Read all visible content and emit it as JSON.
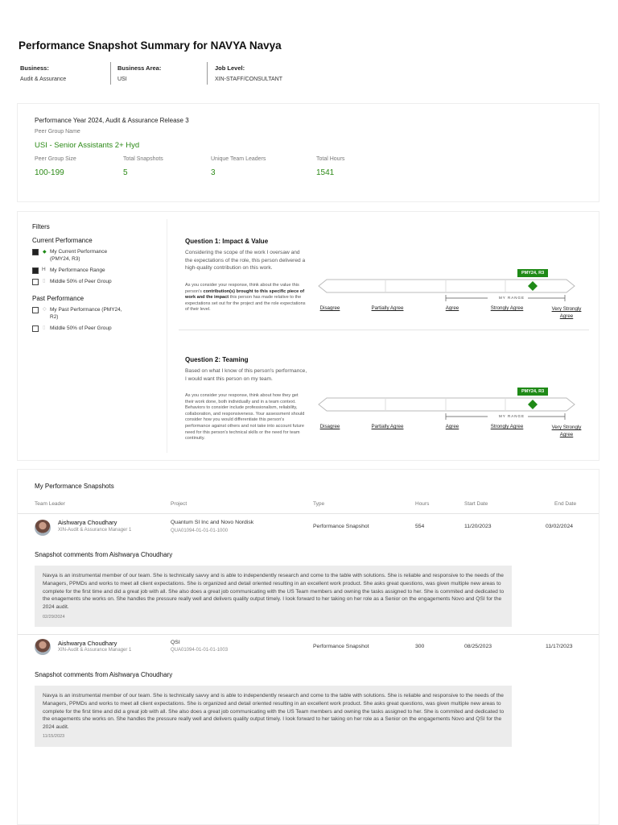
{
  "page": {
    "title": "Performance Snapshot Summary for NAVYA Navya"
  },
  "meta": {
    "business_label": "Business:",
    "business_value": "Audit & Assurance",
    "area_label": "Business Area:",
    "area_value": "USI",
    "level_label": "Job Level:",
    "level_value": "XIN-STAFF/CONSULTANT"
  },
  "summary": {
    "year_title": "Performance Year 2024, Audit & Assurance Release 3",
    "peer_group_label": "Peer Group Name",
    "peer_group_value": "USI - Senior Assistants 2+ Hyd",
    "stats": [
      {
        "label": "Peer Group Size",
        "value": "100-199"
      },
      {
        "label": "Total Snapshots",
        "value": "5"
      },
      {
        "label": "Unique Team Leaders",
        "value": "3"
      },
      {
        "label": "Total Hours",
        "value": "1541"
      }
    ]
  },
  "filters": {
    "title": "Filters",
    "current_heading": "Current Performance",
    "current_items": [
      {
        "label": "My Current Performance (PMY24, R3)",
        "checked": true
      },
      {
        "label": "My Performance Range",
        "checked": true
      },
      {
        "label": "Middle 50% of Peer Group",
        "checked": false
      }
    ],
    "past_heading": "Past Performance",
    "past_items": [
      {
        "label": "My Past Performance (PMY24, R2)",
        "checked": false
      },
      {
        "label": "Middle 50% of Peer Group",
        "checked": false
      }
    ]
  },
  "questions": [
    {
      "title": "Question 1: Impact & Value",
      "text": "Considering the scope of the work I oversaw and the expectations of the role, this person delivered a high-quality contribution on this work.",
      "note_pre": "As you consider your response, think about the value this person's ",
      "note_bold": "contribution(s) brought to this specific piece of work and the impact",
      "note_post": " this person has made relative to the expectations set out for the project and the role expectations of their level.",
      "badge": "PMY24, R3",
      "range_label": "MY RANGE",
      "scale": [
        "Disagree",
        "Partially Agree",
        "Agree",
        "Strongly Agree",
        "Very Strongly Agree"
      ]
    },
    {
      "title": "Question 2: Teaming",
      "text": "Based on what I know of this person's performance, I would want this person on my team.",
      "note_pre": "As you consider your response, think about how they get their work done, both individually and in a team context. Behaviors to consider include professionalism, reliability, collaboration, and responsiveness. Your assessment should consider how you would differentiate this person's performance against others and not take into account future need for this person's technical skills or the need for team continuity.",
      "note_bold": "",
      "note_post": "",
      "badge": "PMY24, R3",
      "range_label": "MY RANGE",
      "scale": [
        "Disagree",
        "Partially Agree",
        "Agree",
        "Strongly Agree",
        "Very Strongly Agree"
      ]
    }
  ],
  "snapshots": {
    "title": "My Performance Snapshots",
    "columns": [
      "Team Leader",
      "Project",
      "Type",
      "Hours",
      "Start Date",
      "End Date"
    ],
    "rows": [
      {
        "leader": "Aishwarya Choudhary",
        "leader_role": "XIN-Audit & Assurance Manager 1",
        "project": "Quantum SI Inc and Novo Nordisk",
        "project_code": "QUA01094-01-01-01-1000",
        "type": "Performance Snapshot",
        "hours": "554",
        "start": "11/20/2023",
        "end": "03/02/2024",
        "comment_heading": "Snapshot comments from Aishwarya Choudhary",
        "comment": "Navya is an instrumental member of our team. She is technically savvy and is able to independently research and come to the table with solutions. She is reliable and responsive to the needs of the Managers, PPMDs and works to meet all client expectations. She is organized and detail oriented resulting in an excellent work product. She asks great questions, was given multiple new areas to complete for the first time and did a great job with all. She also does a great job communicating with the US Team members and owning the tasks assigned to her. She is commited and dedicated to the enagements she works on. She handles the pressure really well and delivers quality output timely. I look forward to her taking on her role as a Senior on the engagements Novo and QSI for the 2024 audit.",
        "comment_date": "02/29/2024"
      },
      {
        "leader": "Aishwarya Choudhary",
        "leader_role": "XIN-Audit & Assurance Manager 1",
        "project": "QSI",
        "project_code": "QUA01094-01-01-01-1003",
        "type": "Performance Snapshot",
        "hours": "300",
        "start": "08/25/2023",
        "end": "11/17/2023",
        "comment_heading": "Snapshot comments from Aishwarya Choudhary",
        "comment": "Navya is an instrumental member of our team. She is technically savvy and is able to independently research and come to the table with solutions. She is reliable and responsive to the needs of the Managers, PPMDs and works to meet all client expectations. She is organized and detail oriented resulting in an excellent work product. She asks great questions, was given multiple new areas to complete for the first time and did a great job with all. She also does a great job communicating with the US Team members and owning the tasks assigned to her. She is commited and dedicated to the enagements she works on. She handles the pressure really well and delivers quality output timely. I look forward to her taking on her role as a Senior on the engagements Novo and QSI for the 2024 audit.",
        "comment_date": "11/15/2023"
      }
    ]
  },
  "colors": {
    "accent": "#2c8a17",
    "badge": "#1f8a17",
    "comment_bg": "#ececec"
  },
  "icons": {
    "avatar": "user-photo",
    "diamond": "diamond-marker",
    "checkbox": "checkbox"
  }
}
